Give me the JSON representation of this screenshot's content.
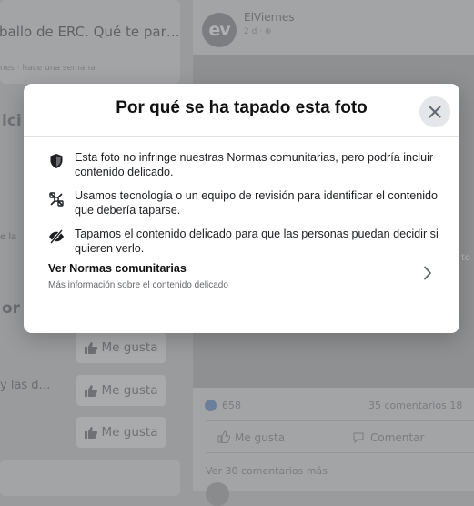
{
  "background": {
    "left_post_snippet": "ballo de ERC. Qué te par…",
    "left_post_meta": "nes · hace una semana",
    "left_partial_heading": "lci",
    "left_fragment_1": "or",
    "left_fragment_2": "y las d…",
    "left_fragment_3": "e la",
    "like_label": "Me gusta",
    "right_post": {
      "author": "ElViernes",
      "time": "2 d · ⊕",
      "avatar_text": "ev",
      "reaction_count": "658",
      "comments_shares": "35 comentarios  18",
      "like_action": "Me gusta",
      "comment_action": "Comentar",
      "more_comments": "Ver 30 comentarios más",
      "side_label": "to"
    }
  },
  "modal": {
    "title": "Por qué se ha tapado esta foto",
    "items": [
      {
        "icon": "shield-icon",
        "text": "Esta foto no infringe nuestras Normas comunitarias, pero podría incluir contenido delicado."
      },
      {
        "icon": "review-technology-icon",
        "text": "Usamos tecnología o un equipo de revisión para identificar el contenido que debería taparse."
      },
      {
        "icon": "eye-slash-icon",
        "text": "Tapamos el contenido delicado para que las personas puedan decidir si quieren verlo."
      }
    ],
    "link": {
      "title": "Ver Normas comunitarias",
      "subtitle": "Más información sobre el contenido delicado"
    }
  },
  "colors": {
    "overlay_bg": "#9a9b9d",
    "modal_bg": "#ffffff",
    "close_bg": "#e4e6e9",
    "text_primary": "#1c1e21",
    "text_secondary": "#65676b"
  }
}
